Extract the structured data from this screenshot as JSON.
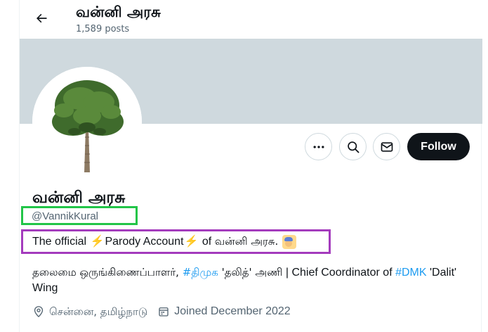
{
  "header": {
    "title": "வன்னி அரசு",
    "post_count": "1,589 posts"
  },
  "actions": {
    "follow_label": "Follow"
  },
  "profile": {
    "display_name": "வன்னி அரசு",
    "handle": "@VannikKural",
    "bio": {
      "prefix": "The official ",
      "middle": "Parody Account",
      "suffix": " of ",
      "name_ta": "வன்னி அரசு.",
      "bolt": "⚡"
    },
    "description": {
      "part1": "தலைமை ஒருங்கிணைப்பாளர், ",
      "tag1": "#திமுக",
      "part2": " 'தலித்' அணி",
      "part3": " | Chief Coordinator of ",
      "tag2": "#DMK",
      "part4": " 'Dalit' Wing"
    },
    "location": "சென்னை, தமிழ்நாடு",
    "joined": "Joined December 2022"
  },
  "colors": {
    "handle_box": "#22c548",
    "bio_box": "#a43bbd",
    "link": "#1d9bf0",
    "banner": "#cfd9de"
  }
}
